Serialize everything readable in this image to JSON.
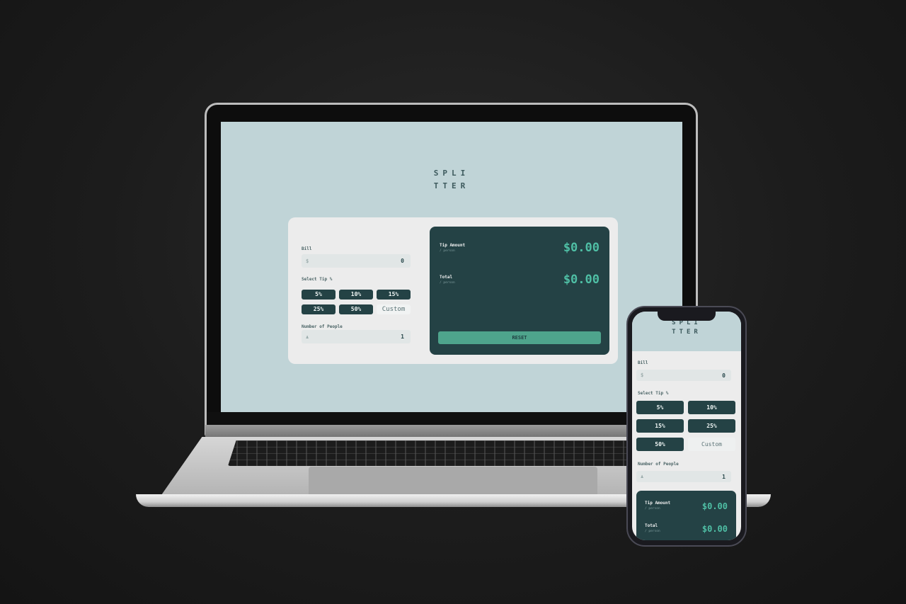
{
  "app": {
    "logo_line1": "SPLI",
    "logo_line2": "TTER"
  },
  "form": {
    "bill_label": "Bill",
    "bill_icon": "$",
    "bill_value": "0",
    "tip_label": "Select Tip %",
    "tip_options": [
      "5%",
      "10%",
      "15%",
      "25%",
      "50%"
    ],
    "custom_label": "Custom",
    "people_label": "Number of People",
    "people_icon": "person-icon",
    "people_value": "1"
  },
  "results": {
    "tip_title": "Tip Amount",
    "tip_sub": "/ person",
    "tip_value": "$0.00",
    "total_title": "Total",
    "total_sub": "/ person",
    "total_value": "$0.00",
    "reset_label": "RESET"
  },
  "colors": {
    "background": "#1c1c1c",
    "screen_bg": "#c0d4d7",
    "dark_teal": "#244245",
    "accent": "#4fbfa5",
    "reset": "#4ea48c"
  }
}
